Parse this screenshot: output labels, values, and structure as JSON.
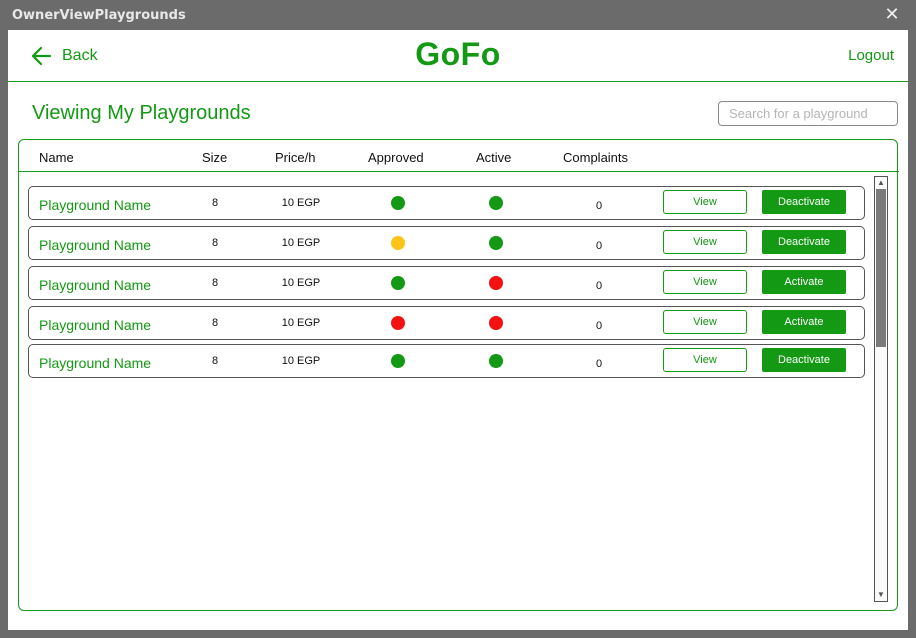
{
  "window": {
    "title": "OwnerViewPlaygrounds",
    "close_glyph": "✕"
  },
  "topbar": {
    "back_label": "Back",
    "brand": "GoFo",
    "logout_label": "Logout"
  },
  "page": {
    "title": "Viewing My Playgrounds"
  },
  "search": {
    "placeholder": "Search for a playground",
    "value": ""
  },
  "table": {
    "headers": {
      "name": "Name",
      "size": "Size",
      "price": "Price/h",
      "approved": "Approved",
      "active": "Active",
      "complaints": "Complaints"
    },
    "rows": [
      {
        "name": "Playground Name",
        "size": "8",
        "price": "10 EGP",
        "approved": "green",
        "active": "green",
        "complaints": "0",
        "view_label": "View",
        "action_label": "Deactivate"
      },
      {
        "name": "Playground Name",
        "size": "8",
        "price": "10 EGP",
        "approved": "yellow",
        "active": "green",
        "complaints": "0",
        "view_label": "View",
        "action_label": "Deactivate"
      },
      {
        "name": "Playground Name",
        "size": "8",
        "price": "10 EGP",
        "approved": "green",
        "active": "red",
        "complaints": "0",
        "view_label": "View",
        "action_label": "Activate"
      },
      {
        "name": "Playground Name",
        "size": "8",
        "price": "10 EGP",
        "approved": "red",
        "active": "red",
        "complaints": "0",
        "view_label": "View",
        "action_label": "Activate"
      },
      {
        "name": "Playground Name",
        "size": "8",
        "price": "10 EGP",
        "approved": "green",
        "active": "green",
        "complaints": "0",
        "view_label": "View",
        "action_label": "Deactivate"
      }
    ]
  },
  "colors": {
    "accent": "#139913",
    "status_green": "#139913",
    "status_yellow": "#fcc419",
    "status_red": "#f21212"
  },
  "icons": {
    "back": "arrow-left-icon",
    "close": "close-icon"
  }
}
